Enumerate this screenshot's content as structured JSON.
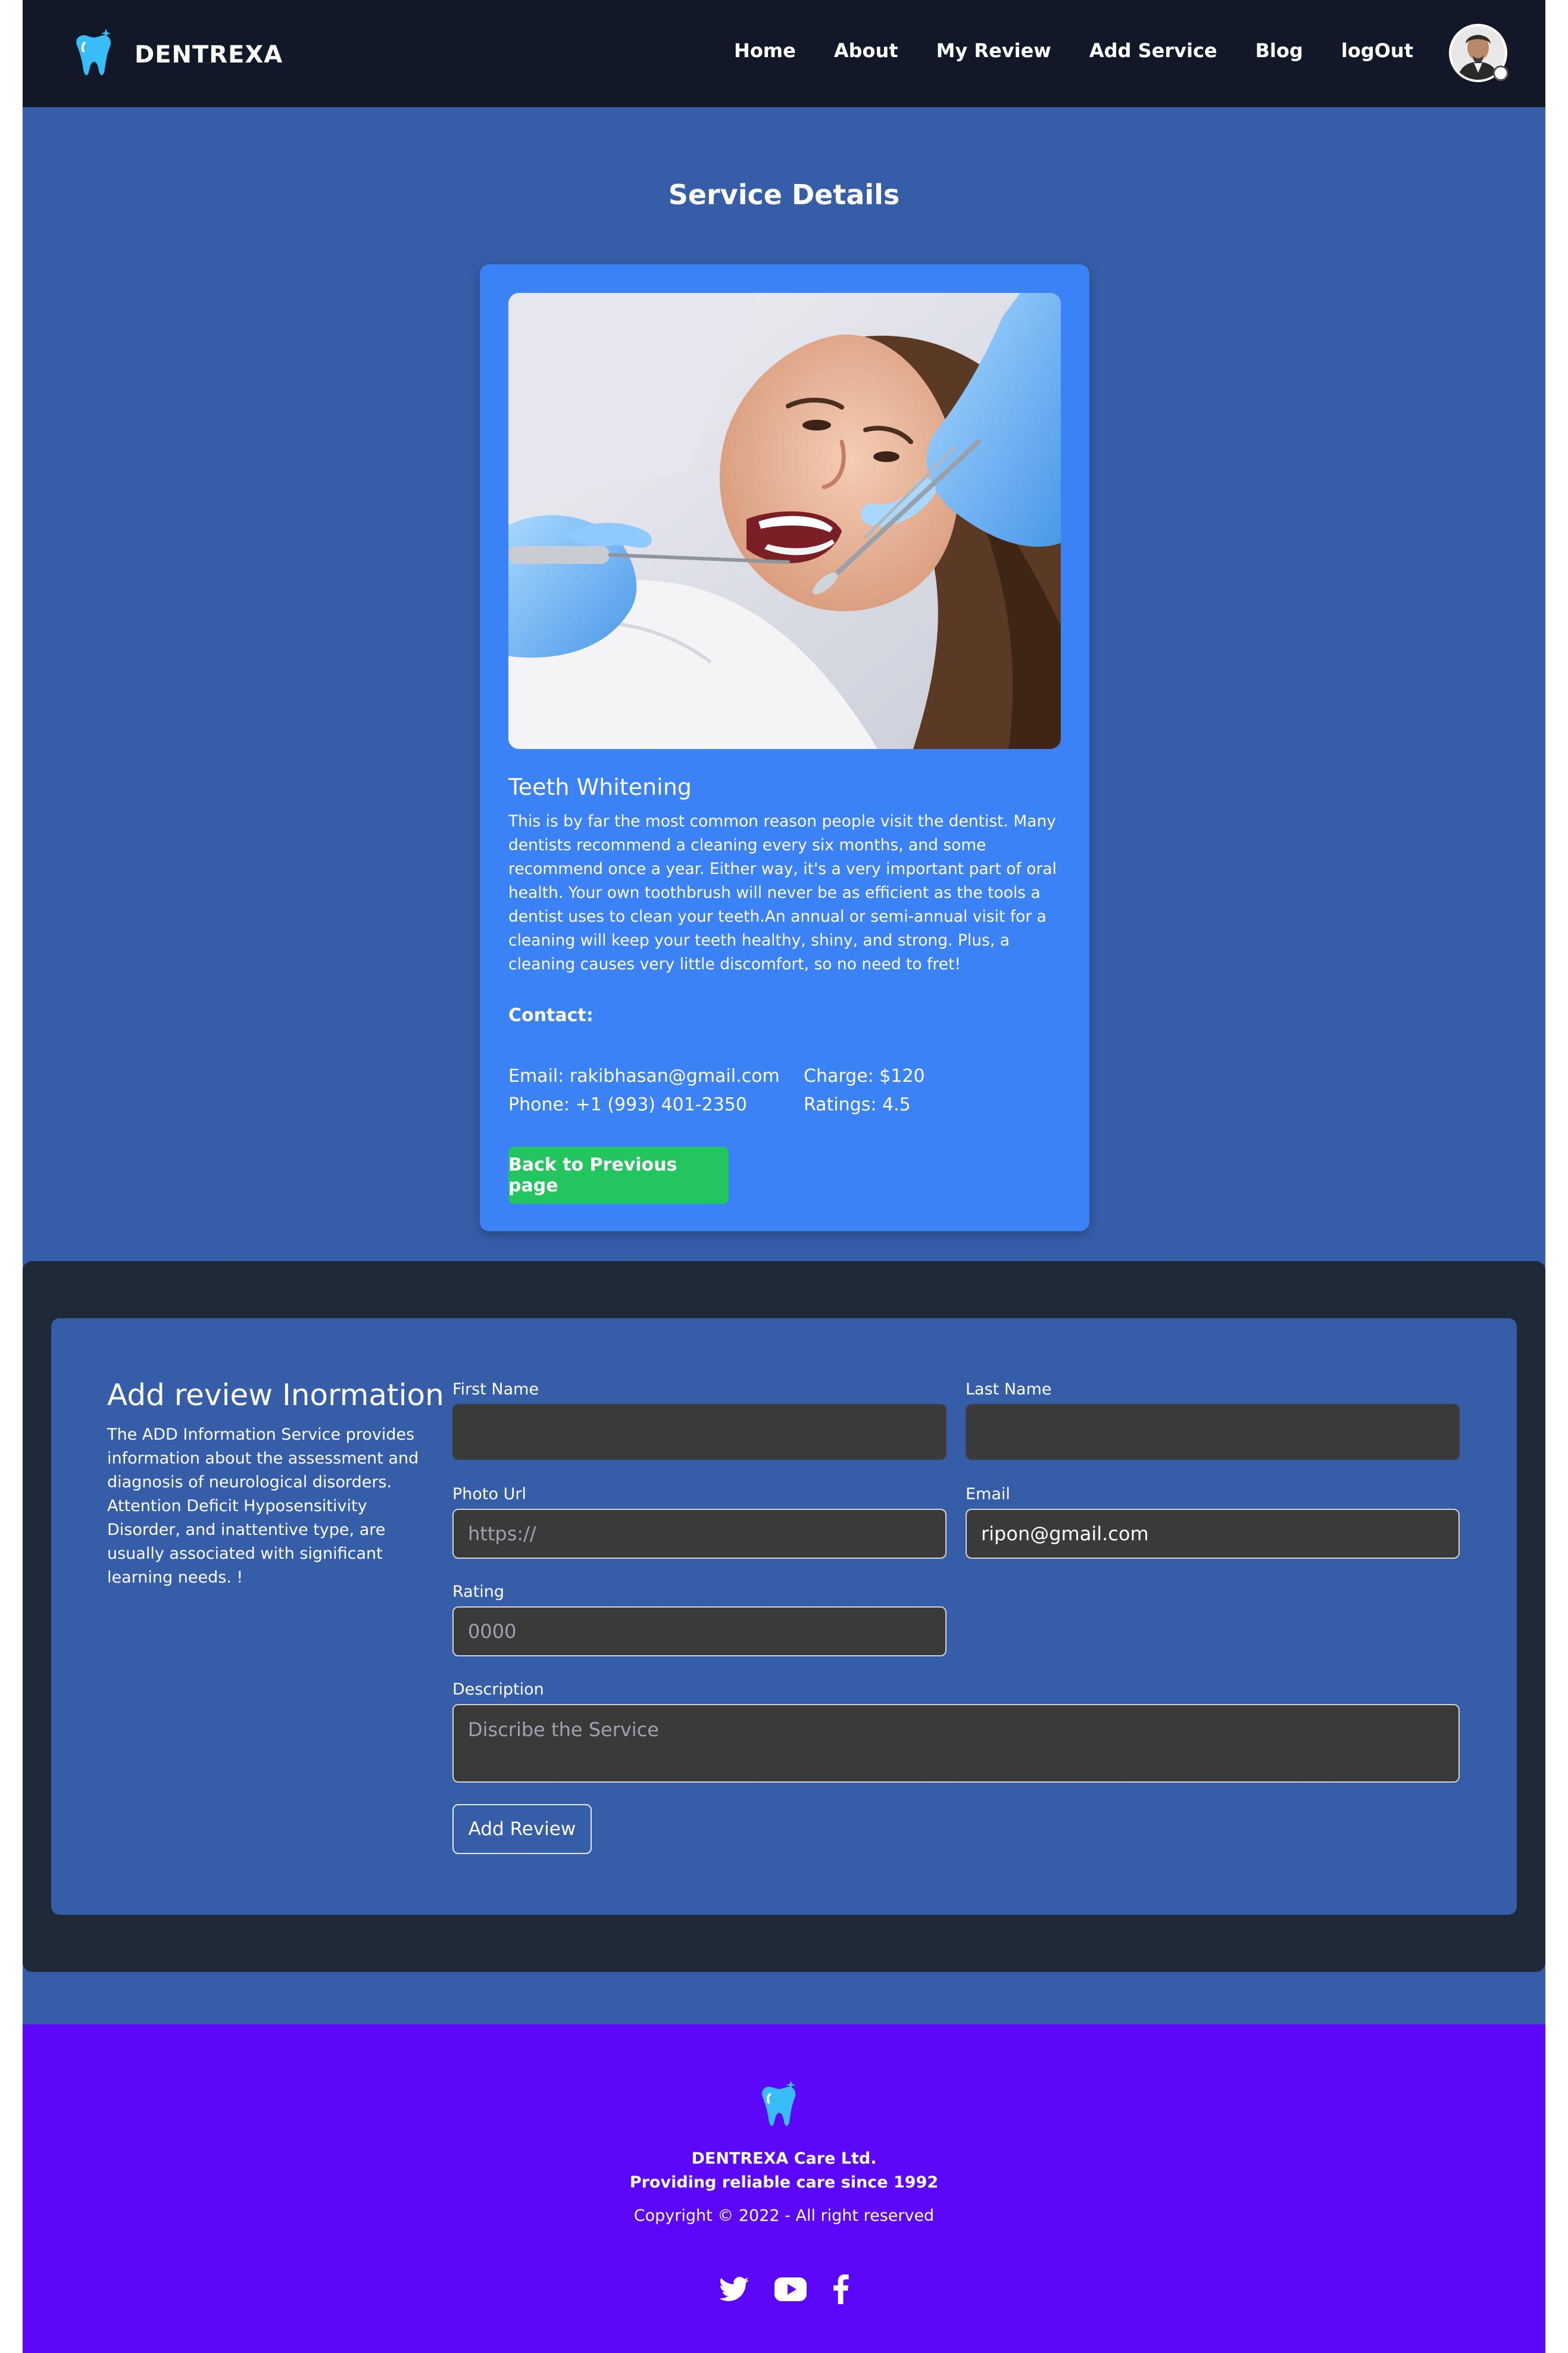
{
  "navbar": {
    "brand": "DENTREXA",
    "links": [
      "Home",
      "About",
      "My Review",
      "Add Service",
      "Blog",
      "logOut"
    ]
  },
  "service": {
    "page_title": "Service Details",
    "name": "Teeth Whitening",
    "description": "This is by far the most common reason people visit the dentist. Many dentists recommend a cleaning every six months, and some recommend once a year. Either way, it's a very important part of oral health. Your own toothbrush will never be as efficient as the tools a dentist uses to clean your teeth.An annual or semi-annual visit for a cleaning will keep your teeth healthy, shiny, and strong. Plus, a cleaning causes very little discomfort, so no need to fret!",
    "contact_heading": "Contact:",
    "email": "Email: rakibhasan@gmail.com",
    "phone": "Phone: +1 (993) 401-2350",
    "charge": "Charge: $120",
    "ratings": "Ratings: 4.5",
    "back_button": "Back to Previous page"
  },
  "review": {
    "title": "Add review Inormation",
    "description": "The ADD Information Service provides information about the assessment and diagnosis of neurological disorders. Attention Deficit Hyposensitivity Disorder, and inattentive type, are usually associated with significant learning needs. !",
    "fields": {
      "first_name": {
        "label": "First Name",
        "value": ""
      },
      "last_name": {
        "label": "Last Name",
        "value": ""
      },
      "photo_url": {
        "label": "Photo Url",
        "placeholder": "https://"
      },
      "email": {
        "label": "Email",
        "value": "ripon@gmail.com"
      },
      "rating": {
        "label": "Rating",
        "placeholder": "0000"
      },
      "description": {
        "label": "Description",
        "placeholder": "Discribe the Service"
      }
    },
    "submit_button": "Add Review"
  },
  "footer": {
    "company": "DENTREXA Care Ltd.",
    "tagline": "Providing reliable care since 1992",
    "copyright": "Copyright © 2022 - All right reserved",
    "socials": [
      "twitter-icon",
      "youtube-icon",
      "facebook-icon"
    ]
  },
  "colors": {
    "navbar": "#111827",
    "page_bg": "#365ea8",
    "card": "#3b82f6",
    "back_button": "#22c55e",
    "review_outer": "#1f2937",
    "input_bg": "#3a3a3a",
    "footer": "#5a07fa",
    "logo": "#38bdf8"
  }
}
